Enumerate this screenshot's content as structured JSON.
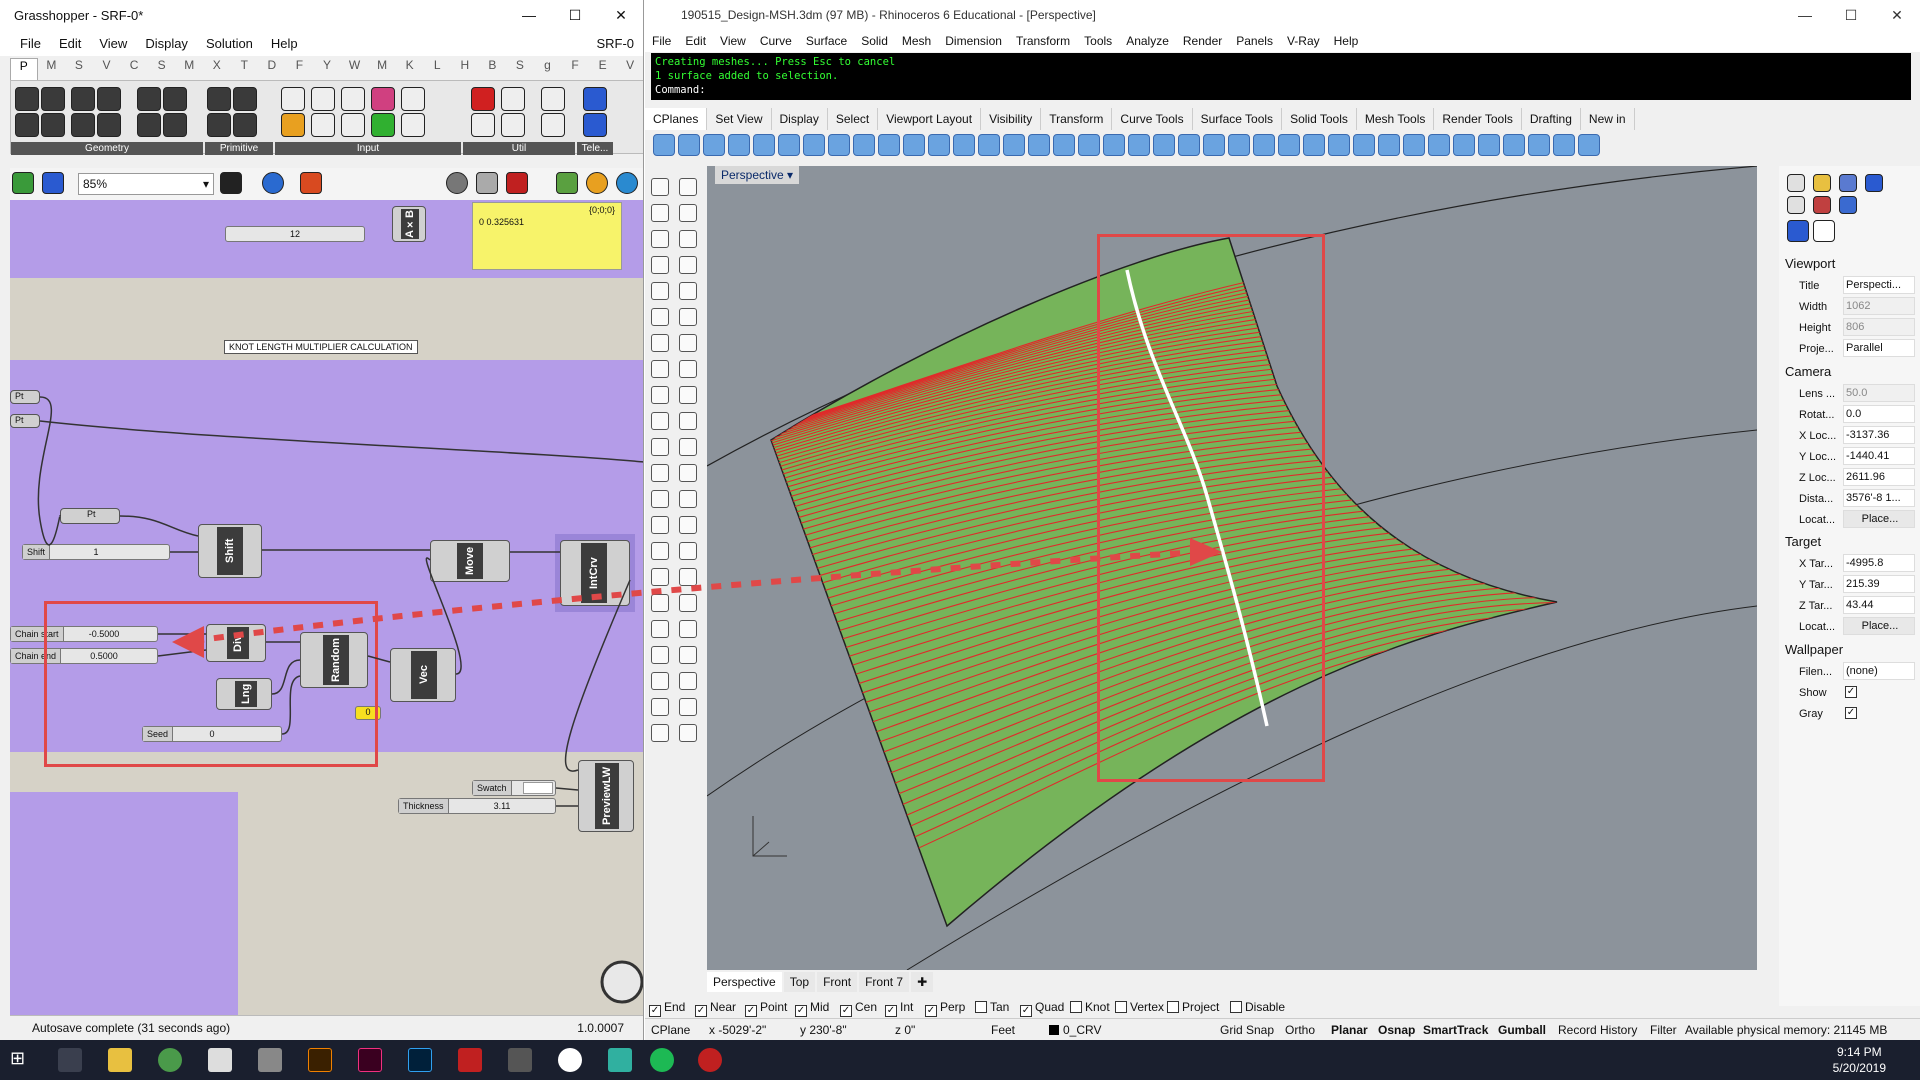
{
  "gh": {
    "title": "Grasshopper - SRF-0*",
    "doc_label": "SRF-0",
    "menu": [
      "File",
      "Edit",
      "View",
      "Display",
      "Solution",
      "Help"
    ],
    "tabs": [
      "P",
      "M",
      "S",
      "V",
      "C",
      "S",
      "M",
      "X",
      "T",
      "D",
      "F",
      "Y",
      "W",
      "M",
      "K",
      "L",
      "H",
      "B",
      "S",
      "g",
      "F",
      "E",
      "V"
    ],
    "ribbon_groups": [
      "Geometry",
      "Primitive",
      "Input",
      "Util",
      "Tele..."
    ],
    "zoom": "85%",
    "panel_text": "0 0.325631",
    "panel_path": "{0;0;0}",
    "group_label": "KNOT LENGTH MULTIPLIER CALCULATION",
    "components": {
      "mult": "A×B",
      "shift": "Shift",
      "move": "Move",
      "intcrv": "IntCrv",
      "div": "Div",
      "random": "Random",
      "len": "Lng",
      "vec": "Vec",
      "preview": "PreviewLW",
      "pt": "Pt"
    },
    "sliders": {
      "twelve": "12",
      "shift_label": "Shift",
      "shift_val": "1",
      "chain_start_label": "Chain start",
      "chain_start_val": "-0.5000",
      "chain_end_label": "Chain end",
      "chain_end_val": "0.5000",
      "seed_label": "Seed",
      "seed_val": "0",
      "swatch": "Swatch",
      "thickness_label": "Thickness",
      "thickness_val": "3.11"
    },
    "pt_label": "Pt",
    "panel_small": "0",
    "status": "Autosave complete (31 seconds ago)",
    "version": "1.0.0007"
  },
  "rhino": {
    "title": "190515_Design-MSH.3dm (97 MB) - Rhinoceros 6 Educational - [Perspective]",
    "menu": [
      "File",
      "Edit",
      "View",
      "Curve",
      "Surface",
      "Solid",
      "Mesh",
      "Dimension",
      "Transform",
      "Tools",
      "Analyze",
      "Render",
      "Panels",
      "V-Ray",
      "Help"
    ],
    "cmd_lines": [
      "Creating meshes... Press Esc to cancel",
      "1 surface added to selection."
    ],
    "cmd_prompt": "Command:",
    "tabs": [
      "CPlanes",
      "Set View",
      "Display",
      "Select",
      "Viewport Layout",
      "Visibility",
      "Transform",
      "Curve Tools",
      "Surface Tools",
      "Solid Tools",
      "Mesh Tools",
      "Render Tools",
      "Drafting",
      "New in"
    ],
    "viewport_title": "Perspective",
    "viewport_tabs": [
      "Perspective",
      "Top",
      "Front",
      "Front 7"
    ],
    "props": {
      "viewport_h": "Viewport",
      "title_k": "Title",
      "title_v": "Perspecti...",
      "width_k": "Width",
      "width_v": "1062",
      "height_k": "Height",
      "height_v": "806",
      "proj_k": "Proje...",
      "proj_v": "Parallel",
      "camera_h": "Camera",
      "lens_k": "Lens ...",
      "lens_v": "50.0",
      "rot_k": "Rotat...",
      "rot_v": "0.0",
      "xloc_k": "X Loc...",
      "xloc_v": "-3137.36",
      "yloc_k": "Y Loc...",
      "yloc_v": "-1440.41",
      "zloc_k": "Z Loc...",
      "zloc_v": "2611.96",
      "dist_k": "Dista...",
      "dist_v": "3576'-8 1...",
      "locat_k": "Locat...",
      "locat_v": "Place...",
      "target_h": "Target",
      "xtar_k": "X Tar...",
      "xtar_v": "-4995.8",
      "ytar_k": "Y Tar...",
      "ytar_v": "215.39",
      "ztar_k": "Z Tar...",
      "ztar_v": "43.44",
      "locat2_k": "Locat...",
      "locat2_v": "Place...",
      "wall_h": "Wallpaper",
      "file_k": "Filen...",
      "file_v": "(none)",
      "show_k": "Show",
      "gray_k": "Gray"
    },
    "osnap": [
      "End",
      "Near",
      "Point",
      "Mid",
      "Cen",
      "Int",
      "Perp",
      "Tan",
      "Quad",
      "Knot",
      "Vertex",
      "Project",
      "Disable"
    ],
    "status": {
      "cplane": "CPlane",
      "x": "x -5029'-2\"",
      "y": "y 230'-8\"",
      "z": "z 0\"",
      "units": "Feet",
      "layer": "0_CRV",
      "grid": "Grid Snap",
      "ortho": "Ortho",
      "planar": "Planar",
      "osnap": "Osnap",
      "smarttrack": "SmartTrack",
      "gumball": "Gumball",
      "history": "Record History",
      "filter": "Filter",
      "memory": "Available physical memory: 21145 MB"
    }
  },
  "taskbar": {
    "time": "9:14 PM",
    "date": "5/20/2019"
  },
  "colors": {
    "gh_group": "#b49ce8",
    "gh_canvas": "#d6d2c7",
    "panel": "#f7f36a",
    "viewport": "#8c939b",
    "surface_green": "#76b45a",
    "line_red": "#e02a2a",
    "highlight": "#e04848"
  }
}
